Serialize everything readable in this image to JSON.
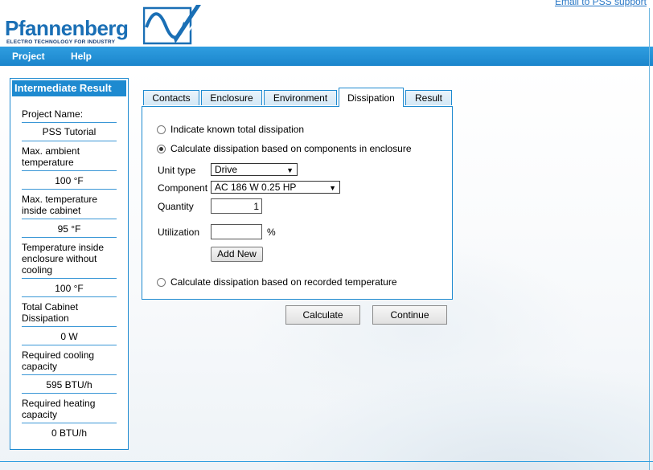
{
  "header": {
    "logo_text": "Pfannenberg",
    "logo_subtitle": "ELECTRO TECHNOLOGY FOR INDUSTRY",
    "support_link": "Email to PSS support",
    "brand_color": "#1a6fb5"
  },
  "menu": {
    "project": "Project",
    "help": "Help"
  },
  "sidebar": {
    "title": "Intermediate Result",
    "items": [
      {
        "label": "Project Name:",
        "value": "PSS Tutorial"
      },
      {
        "label": "Max. ambient temperature",
        "value": "100 °F"
      },
      {
        "label": "Max. temperature inside cabinet",
        "value": "95 °F"
      },
      {
        "label": "Temperature inside enclosure without cooling",
        "value": "100 °F"
      },
      {
        "label": "Total Cabinet Dissipation",
        "value": "0 W"
      },
      {
        "label": "Required cooling capacity",
        "value": "595 BTU/h"
      },
      {
        "label": "Required heating capacity",
        "value": "0 BTU/h"
      }
    ]
  },
  "tabs": [
    {
      "label": "Contacts",
      "active": false
    },
    {
      "label": "Enclosure",
      "active": false
    },
    {
      "label": "Environment",
      "active": false
    },
    {
      "label": "Dissipation",
      "active": true
    },
    {
      "label": "Result",
      "active": false
    }
  ],
  "dissipation": {
    "option_known": "Indicate known total dissipation",
    "option_components": "Calculate dissipation based on components in enclosure",
    "option_recorded": "Calculate dissipation based on recorded temperature",
    "selected_option": "components",
    "unit_type_label": "Unit type",
    "unit_type_value": "Drive",
    "component_label": "Component",
    "component_value": "AC 186 W 0.25 HP",
    "quantity_label": "Quantity",
    "quantity_value": "1",
    "utilization_label": "Utilization",
    "utilization_value": "",
    "utilization_unit": "%",
    "add_new": "Add New"
  },
  "actions": {
    "calculate": "Calculate",
    "continue": "Continue"
  }
}
